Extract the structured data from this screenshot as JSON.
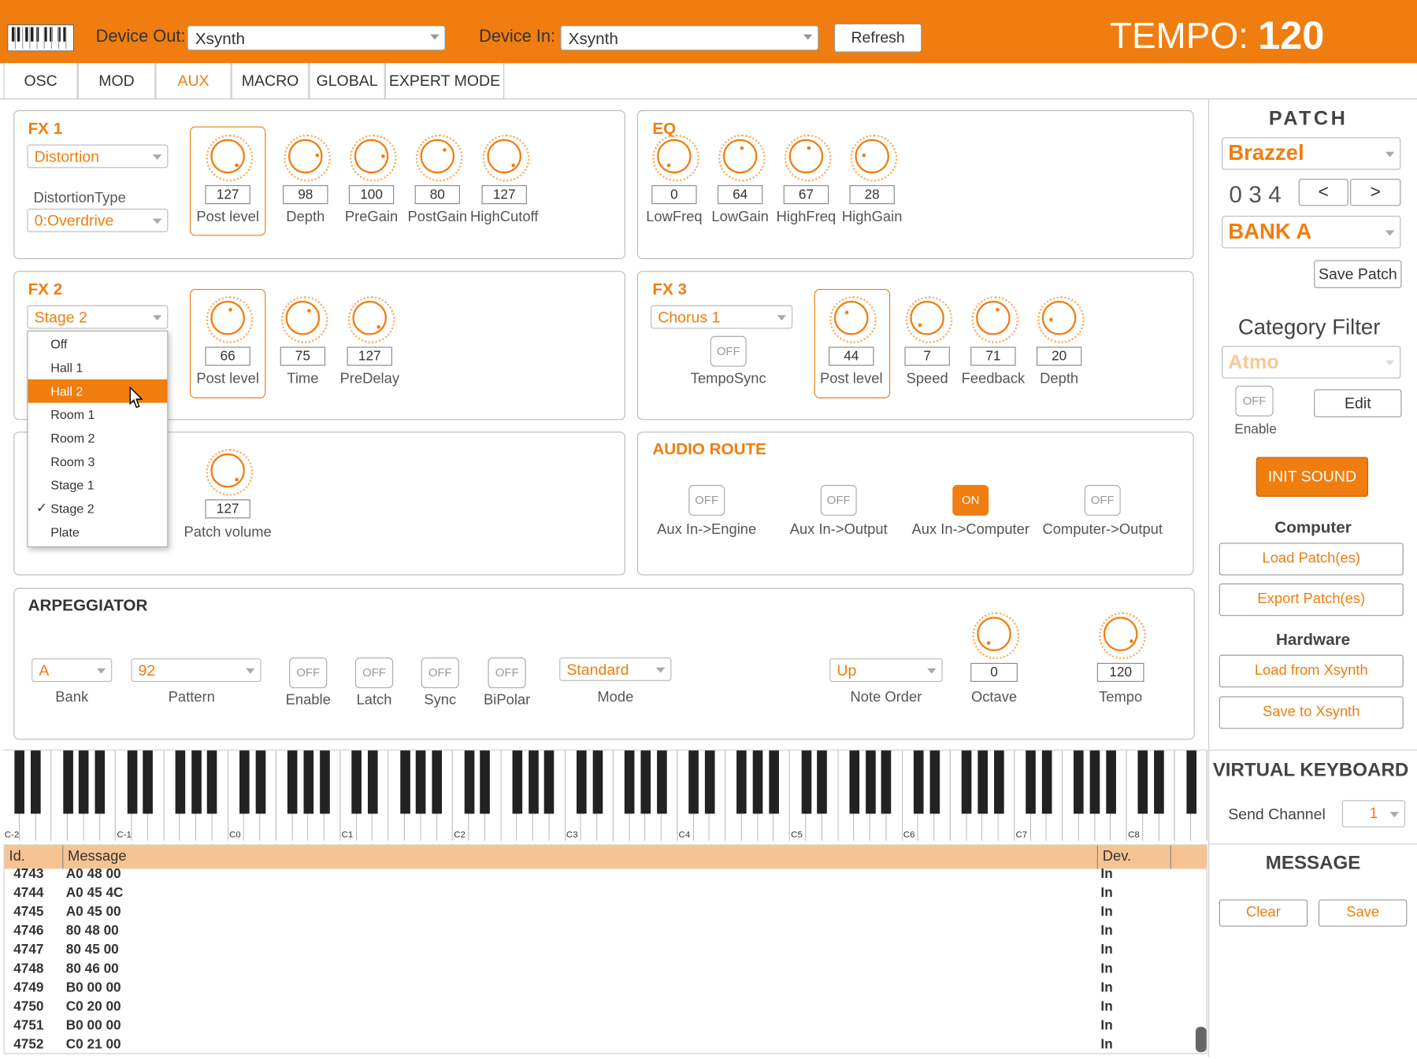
{
  "header": {
    "device_out_label": "Device Out:",
    "device_out_value": "Xsynth",
    "device_in_label": "Device In:",
    "device_in_value": "Xsynth",
    "refresh_label": "Refresh",
    "tempo_label": "TEMPO:",
    "tempo_value": "120"
  },
  "tabs": [
    {
      "label": "OSC"
    },
    {
      "label": "MOD"
    },
    {
      "label": "AUX"
    },
    {
      "label": "MACRO"
    },
    {
      "label": "GLOBAL"
    },
    {
      "label": "EXPERT MODE"
    }
  ],
  "active_tab": "AUX",
  "fx1": {
    "title": "FX 1",
    "type_value": "Distortion",
    "subtype_label": "DistortionType",
    "subtype_value": "0:Overdrive",
    "knobs": [
      {
        "label": "Post level",
        "value": "127"
      },
      {
        "label": "Depth",
        "value": "98"
      },
      {
        "label": "PreGain",
        "value": "100"
      },
      {
        "label": "PostGain",
        "value": "80"
      },
      {
        "label": "HighCutoff",
        "value": "127"
      }
    ]
  },
  "eq": {
    "title": "EQ",
    "knobs": [
      {
        "label": "LowFreq",
        "value": "0"
      },
      {
        "label": "LowGain",
        "value": "64"
      },
      {
        "label": "HighFreq",
        "value": "67"
      },
      {
        "label": "HighGain",
        "value": "28"
      }
    ]
  },
  "fx2": {
    "title": "FX 2",
    "type_value": "Stage 2",
    "knobs": [
      {
        "label": "Post level",
        "value": "66"
      },
      {
        "label": "Time",
        "value": "75"
      },
      {
        "label": "PreDelay",
        "value": "127"
      }
    ],
    "menu": [
      {
        "label": "Off"
      },
      {
        "label": "Hall 1"
      },
      {
        "label": "Hall 2"
      },
      {
        "label": "Room 1"
      },
      {
        "label": "Room 2"
      },
      {
        "label": "Room 3"
      },
      {
        "label": "Stage 1"
      },
      {
        "label": "Stage 2"
      },
      {
        "label": "Plate"
      }
    ],
    "menu_highlight": "Hall 2",
    "menu_checked": "Stage 2",
    "check_mark": "✓"
  },
  "fx3": {
    "title": "FX 3",
    "type_value": "Chorus 1",
    "temposync_state": "OFF",
    "temposync_label": "TempoSync",
    "knobs": [
      {
        "label": "Post level",
        "value": "44"
      },
      {
        "label": "Speed",
        "value": "7"
      },
      {
        "label": "Feedback",
        "value": "71"
      },
      {
        "label": "Depth",
        "value": "20"
      }
    ]
  },
  "volume": {
    "label": "Patch volume",
    "value": "127"
  },
  "audio_route": {
    "title": "AUDIO  ROUTE",
    "items": [
      {
        "label": "Aux In->Engine",
        "state": "OFF"
      },
      {
        "label": "Aux In->Output",
        "state": "OFF"
      },
      {
        "label": "Aux In->Computer",
        "state": "ON"
      },
      {
        "label": "Computer->Output",
        "state": "OFF"
      }
    ]
  },
  "arp": {
    "title": "ARPEGGIATOR",
    "bank_value": "A",
    "bank_label": "Bank",
    "pattern_value": "92",
    "pattern_label": "Pattern",
    "toggles": [
      {
        "label": "Enable",
        "state": "OFF"
      },
      {
        "label": "Latch",
        "state": "OFF"
      },
      {
        "label": "Sync",
        "state": "OFF"
      },
      {
        "label": "BiPolar",
        "state": "OFF"
      }
    ],
    "mode_value": "Standard",
    "mode_label": "Mode",
    "note_order_value": "Up",
    "note_order_label": "Note Order",
    "octave_label": "Octave",
    "octave_value": "0",
    "tempo_label": "Tempo",
    "tempo_value": "120"
  },
  "keyboard": {
    "octaves": [
      "C-2",
      "C-1",
      "C0",
      "C1",
      "C2",
      "C3",
      "C4",
      "C5",
      "C6",
      "C7",
      "C8"
    ]
  },
  "log": {
    "col_id": "Id.",
    "col_msg": "Message",
    "col_dev": "Dev.",
    "rows": [
      {
        "id": "4743",
        "msg": "A0 48 00",
        "dev": "In"
      },
      {
        "id": "4744",
        "msg": "A0 45 4C",
        "dev": "In"
      },
      {
        "id": "4745",
        "msg": "A0 45 00",
        "dev": "In"
      },
      {
        "id": "4746",
        "msg": "80 48 00",
        "dev": "In"
      },
      {
        "id": "4747",
        "msg": "80 45 00",
        "dev": "In"
      },
      {
        "id": "4748",
        "msg": "80 46 00",
        "dev": "In"
      },
      {
        "id": "4749",
        "msg": "B0 00 00",
        "dev": "In"
      },
      {
        "id": "4750",
        "msg": "C0 20 00",
        "dev": "In"
      },
      {
        "id": "4751",
        "msg": "B0 00 00",
        "dev": "In"
      },
      {
        "id": "4752",
        "msg": "C0 21 00",
        "dev": "In"
      }
    ]
  },
  "sidebar": {
    "patch_title": "PATCH",
    "patch_name": "Brazzel",
    "patch_number": "0 3 4",
    "prev": "<",
    "next": ">",
    "bank": "BANK A",
    "save_patch": "Save Patch",
    "category_title": "Category Filter",
    "category_value": "Atmo",
    "enable_state": "OFF",
    "enable_label": "Enable",
    "edit_label": "Edit",
    "init_sound": "INIT  SOUND",
    "computer_title": "Computer",
    "load_patches": "Load Patch(es)",
    "export_patches": "Export Patch(es)",
    "hardware_title": "Hardware",
    "load_from": "Load from Xsynth",
    "save_to": "Save to Xsynth",
    "vk_title": "VIRTUAL KEYBOARD",
    "send_channel_label": "Send Channel",
    "send_channel_value": "1",
    "message_title": "MESSAGE",
    "clear_label": "Clear",
    "save_label": "Save"
  },
  "colors": {
    "accent": "#f07d0f",
    "log_header": "#f8c392"
  }
}
